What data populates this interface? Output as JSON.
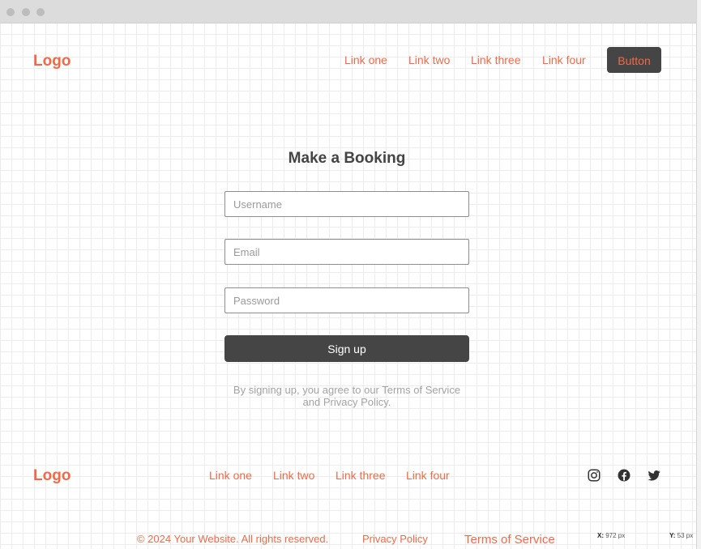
{
  "window": {
    "title_dots": 3
  },
  "header": {
    "logo": "Logo",
    "links": [
      "Link one",
      "Link two",
      "Link three",
      "Link four"
    ],
    "button_label": "Button"
  },
  "form": {
    "title": "Make a Booking",
    "username_placeholder": "Username",
    "email_placeholder": "Email",
    "password_placeholder": "Password",
    "submit_label": "Sign up",
    "disclaimer_line1": "By signing up, you agree to our Terms of Service",
    "disclaimer_line2": "and Privacy Policy."
  },
  "footer": {
    "logo": "Logo",
    "links": [
      "Link one",
      "Link two",
      "Link three",
      "Link four"
    ],
    "social_icons": [
      "instagram-icon",
      "facebook-icon",
      "twitter-icon"
    ],
    "copyright": "© 2024 Your Website. All rights reserved.",
    "privacy": "Privacy Policy",
    "terms": "Terms of Service"
  },
  "readout": {
    "x_label": "X:",
    "x_value": "972 px",
    "y_label": "Y:",
    "y_value": "53 px"
  },
  "colors": {
    "accent": "#f06a47",
    "dark": "#454545",
    "muted": "#a3a3a3"
  }
}
